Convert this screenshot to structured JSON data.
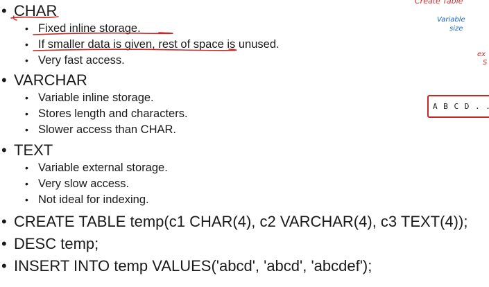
{
  "bullets": [
    {
      "heading": "CHAR",
      "items": [
        "Fixed inline storage.",
        "If smaller data is given, rest of space is unused.",
        "Very fast access."
      ]
    },
    {
      "heading": "VARCHAR",
      "items": [
        "Variable inline storage.",
        "Stores length and characters.",
        "Slower access than CHAR."
      ]
    },
    {
      "heading": "TEXT",
      "items": [
        "Variable external storage.",
        "Very slow access.",
        "Not ideal for indexing."
      ]
    }
  ],
  "statements": [
    "CREATE TABLE temp(c1 CHAR(4), c2 VARCHAR(4), c3 TEXT(4));",
    "DESC temp;",
    "INSERT INTO temp VALUES('abcd', 'abcd', 'abcdef');"
  ],
  "annotations": {
    "create_table": "Create Table",
    "variable_size_line1": "Variable",
    "variable_size_line2": "size",
    "ext_partial": "ex",
    "s_partial": "S",
    "box_text": "A B C D . . . . . ."
  },
  "colors": {
    "text": "#1a1a1a",
    "ink_red": "#c62828",
    "ink_blue": "#1565c0"
  }
}
